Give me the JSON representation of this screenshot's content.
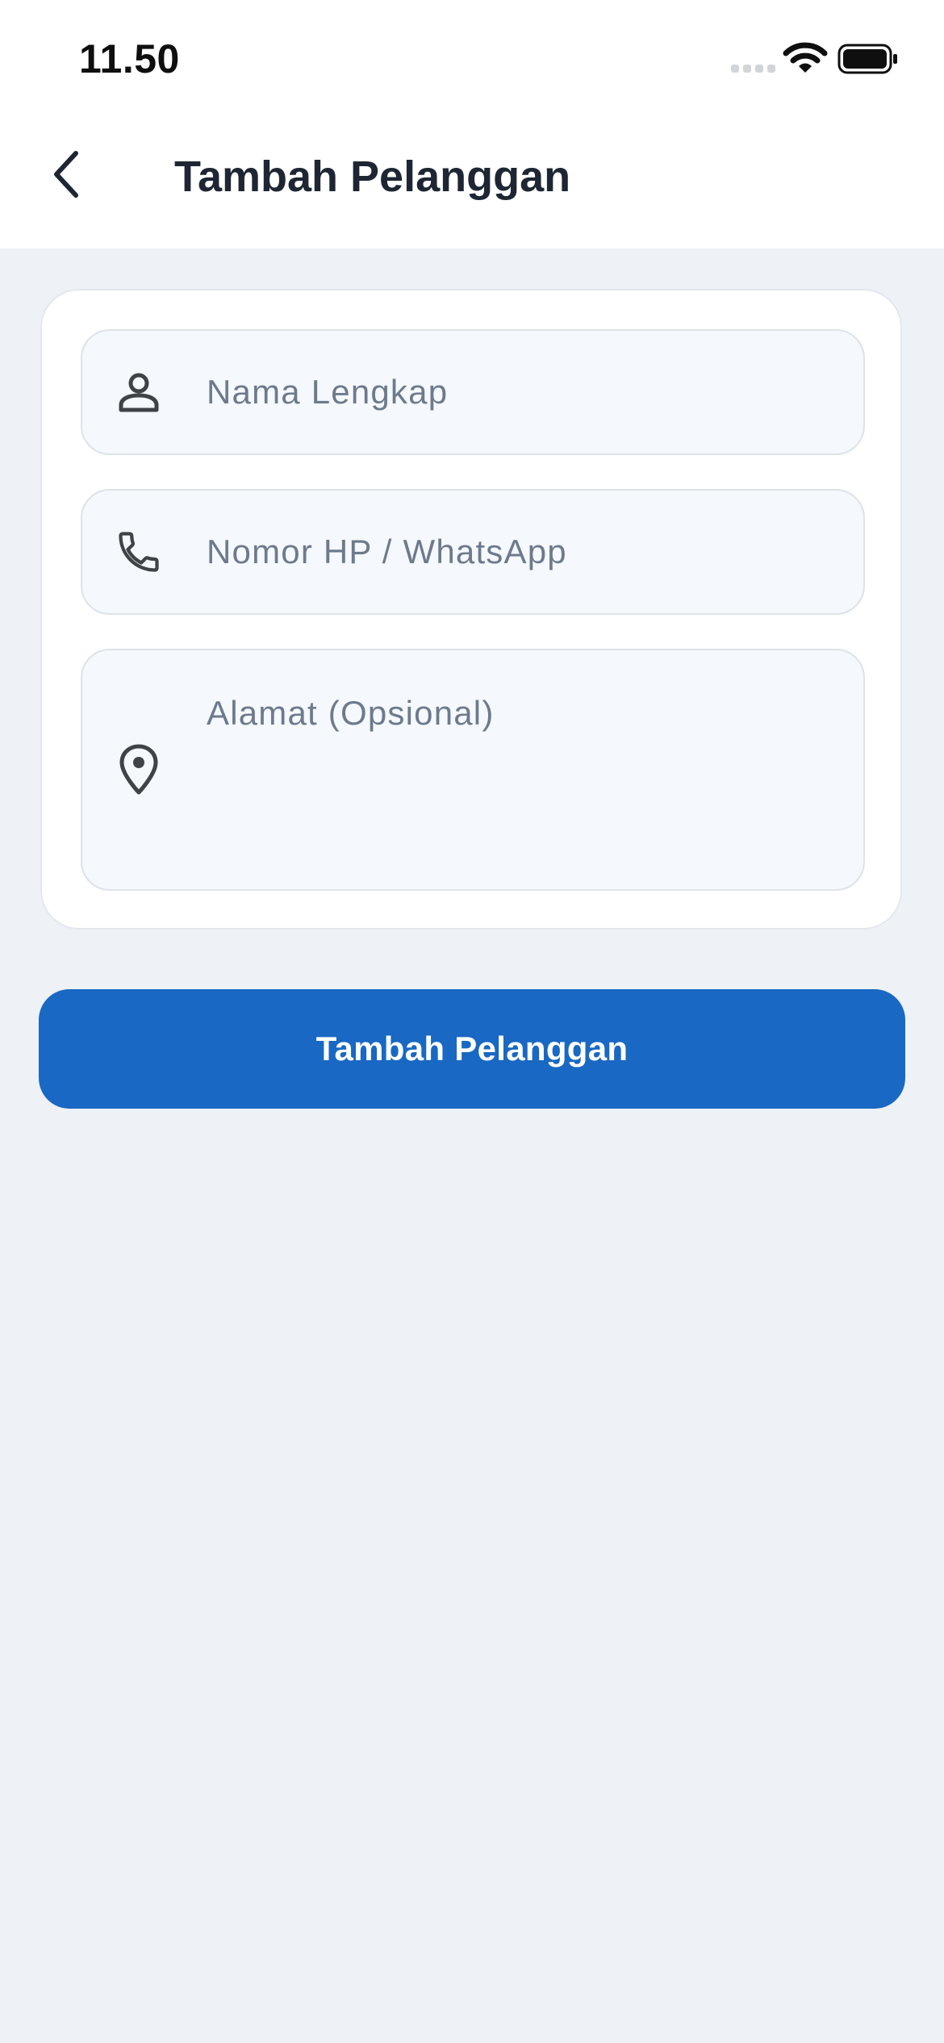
{
  "status_bar": {
    "time": "11.50",
    "icons": [
      "signal-icon",
      "wifi-icon",
      "battery-icon"
    ]
  },
  "app_bar": {
    "back_icon": "chevron-left-icon",
    "title": "Tambah Pelanggan"
  },
  "form": {
    "name": {
      "icon": "person-icon",
      "placeholder": "Nama Lengkap",
      "value": ""
    },
    "phone": {
      "icon": "phone-icon",
      "placeholder": "Nomor HP / WhatsApp",
      "value": ""
    },
    "address": {
      "icon": "location-pin-icon",
      "placeholder": "Alamat (Opsional)",
      "value": ""
    }
  },
  "submit_label": "Tambah Pelanggan",
  "colors": {
    "background": "#EEF1F6",
    "surface": "#FFFFFF",
    "field_background": "#F5F8FC",
    "field_border": "#DDE3EA",
    "placeholder": "#6D7A8D",
    "primary": "#1968C3",
    "title_text": "#1E2633",
    "icon": "#3F4348"
  }
}
